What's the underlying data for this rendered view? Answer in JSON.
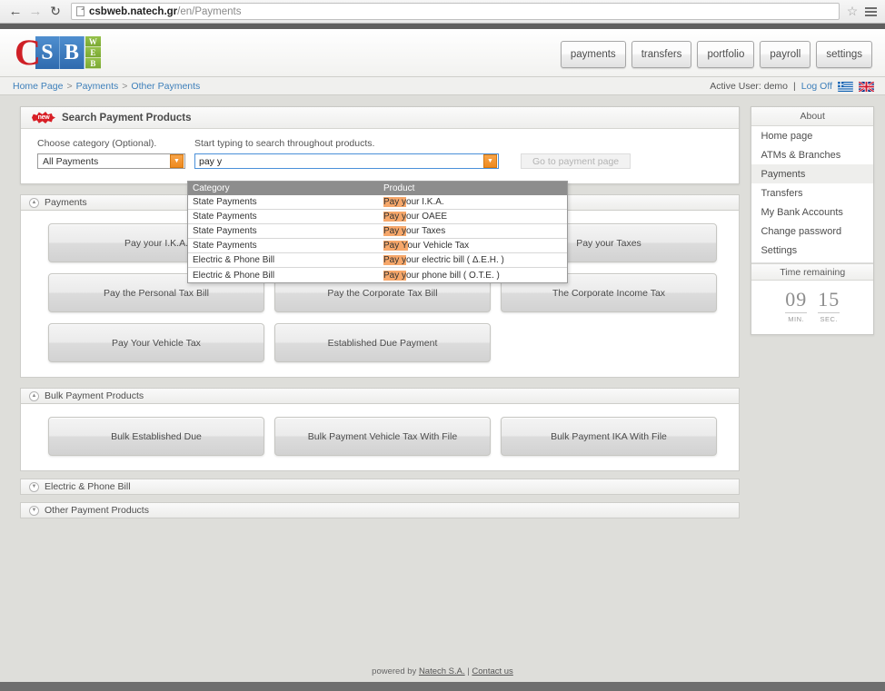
{
  "browser": {
    "back_icon": "back-arrow-icon",
    "forward_icon": "forward-arrow-icon",
    "reload_icon": "reload-icon",
    "url_host": "csbweb.natech.gr",
    "url_path": "/en/Payments",
    "bookmark_icon": "star-icon",
    "menu_icon": "hamburger-menu-icon"
  },
  "header": {
    "logo": {
      "c": "C",
      "s": "S",
      "b": "B",
      "w": "W",
      "e": "E",
      "b2": "B"
    },
    "nav": [
      {
        "label": "payments"
      },
      {
        "label": "transfers"
      },
      {
        "label": "portfolio"
      },
      {
        "label": "payroll"
      },
      {
        "label": "settings"
      }
    ]
  },
  "breadcrumb": {
    "items": [
      "Home Page",
      "Payments",
      "Other Payments"
    ],
    "separator": ">"
  },
  "user": {
    "active_user": "Active User: demo",
    "divider": "|",
    "logoff": "Log Off",
    "flags": [
      "greek-flag-icon",
      "uk-flag-icon"
    ]
  },
  "search_panel": {
    "badge": "new",
    "title": "Search Payment Products",
    "category_label": "Choose category (Optional).",
    "category_value": "All Payments",
    "search_label": "Start typing to search throughout products.",
    "search_value": "pay y",
    "go_button": "Go to payment page"
  },
  "autocomplete": {
    "headers": {
      "category": "Category",
      "product": "Product"
    },
    "rows": [
      {
        "category": "State Payments",
        "hl": "Pay y",
        "rest": "our I.K.A."
      },
      {
        "category": "State Payments",
        "hl": "Pay y",
        "rest": "our OAEE"
      },
      {
        "category": "State Payments",
        "hl": "Pay y",
        "rest": "our Taxes"
      },
      {
        "category": "State Payments",
        "hl": "Pay Y",
        "rest": "our Vehicle Tax"
      },
      {
        "category": "Electric & Phone Bill",
        "hl": "Pay y",
        "rest": "our electric bill ( Δ.Ε.Η. )"
      },
      {
        "category": "Electric & Phone Bill",
        "hl": "Pay y",
        "rest": "our phone bill ( O.T.E. )"
      }
    ]
  },
  "sections": [
    {
      "title": "Payments",
      "expanded": true,
      "chevron": "chevron-up-icon",
      "tiles": [
        "Pay your I.K.A.",
        "Pay your OAEE",
        "Pay your Taxes",
        "Pay the Personal Tax Bill",
        "Pay the Corporate Tax Bill",
        "The Corporate Income Tax",
        "Pay Your Vehicle Tax",
        "Established Due Payment"
      ]
    },
    {
      "title": "Bulk Payment Products",
      "expanded": true,
      "chevron": "chevron-up-icon",
      "tiles": [
        "Bulk Established Due",
        "Bulk Payment Vehicle Tax With File",
        "Bulk Payment IKA With File"
      ]
    },
    {
      "title": "Electric & Phone Bill",
      "expanded": false,
      "chevron": "chevron-down-icon",
      "tiles": []
    },
    {
      "title": "Other Payment Products",
      "expanded": false,
      "chevron": "chevron-down-icon",
      "tiles": []
    }
  ],
  "sidebar": {
    "title": "About",
    "items": [
      {
        "label": "Home page",
        "active": false
      },
      {
        "label": "ATMs & Branches",
        "active": false
      },
      {
        "label": "Payments",
        "active": true
      },
      {
        "label": "Transfers",
        "active": false
      },
      {
        "label": "My Bank Accounts",
        "active": false
      },
      {
        "label": "Change password",
        "active": false
      },
      {
        "label": "Settings",
        "active": false
      }
    ],
    "timer": {
      "title": "Time remaining",
      "minutes": "09",
      "minutes_label": "MIN.",
      "seconds": "15",
      "seconds_label": "SEC."
    }
  },
  "footer": {
    "powered_by": "powered by",
    "company": "Natech S.A.",
    "divider": "|",
    "contact": "Contact us"
  }
}
